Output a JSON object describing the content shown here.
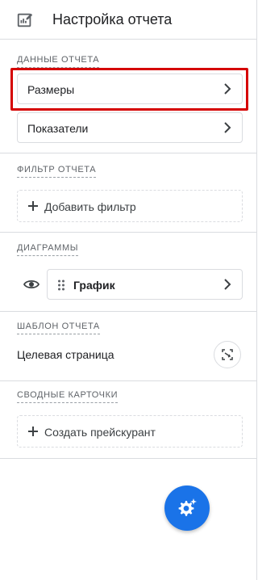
{
  "header": {
    "title": "Настройка отчета",
    "icon": "edit-report-icon"
  },
  "report_data": {
    "section_label": "ДАННЫЕ ОТЧЕТА",
    "items": [
      {
        "label": "Размеры",
        "highlighted": true
      },
      {
        "label": "Показатели"
      }
    ]
  },
  "report_filter": {
    "section_label": "ФИЛЬТР ОТЧЕТА",
    "add_label": "Добавить фильтр"
  },
  "charts": {
    "section_label": "ДИАГРАММЫ",
    "item_label": "График",
    "visible": true
  },
  "report_template": {
    "section_label": "ШАБЛОН ОТЧЕТА",
    "value": "Целевая страница"
  },
  "summary_cards": {
    "section_label": "СВОДНЫЕ КАРТОЧКИ",
    "add_label": "Создать прейскурант"
  },
  "colors": {
    "accent": "#1a73e8",
    "highlight": "#d50000",
    "border": "#dadce0",
    "text": "#202124",
    "muted": "#5f6368"
  }
}
